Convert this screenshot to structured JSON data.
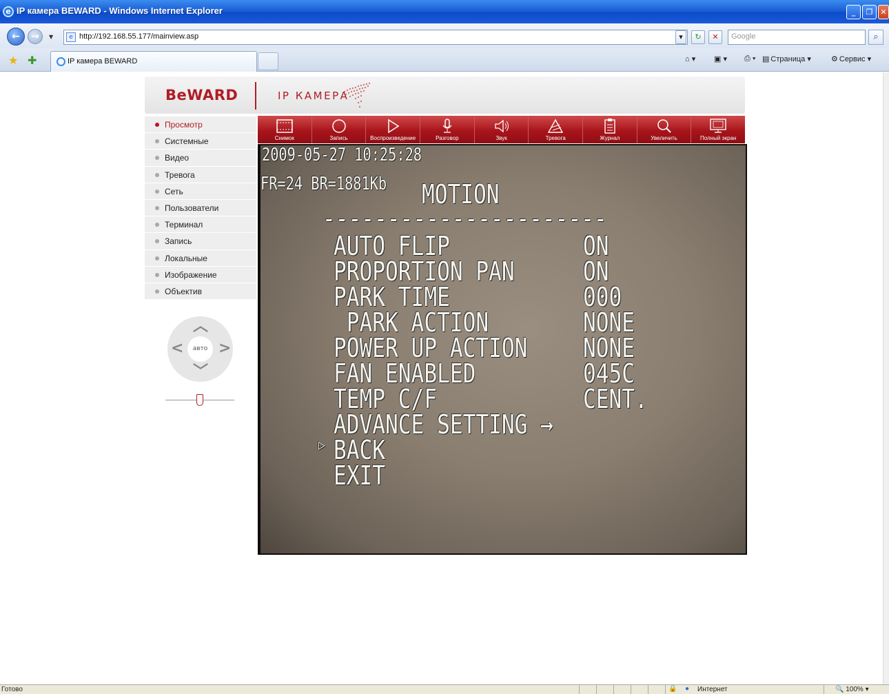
{
  "window": {
    "title": "IP камера BEWARD - Windows Internet Explorer"
  },
  "browser": {
    "url": "http://192.168.55.177/mainview.asp",
    "search_placeholder": "Google",
    "tab_label": "IP камера BEWARD",
    "page_menu": "Страница",
    "tools_menu": "Сервис"
  },
  "header": {
    "logo": "BeWARD",
    "product": "IP КАМЕРА"
  },
  "menu": [
    {
      "label": "Просмотр",
      "active": true
    },
    {
      "label": "Системные"
    },
    {
      "label": "Видео"
    },
    {
      "label": "Тревога"
    },
    {
      "label": "Сеть"
    },
    {
      "label": "Пользователи"
    },
    {
      "label": "Терминал"
    },
    {
      "label": "Запись"
    },
    {
      "label": "Локальные"
    },
    {
      "label": "Изображение"
    },
    {
      "label": "Объектив"
    }
  ],
  "ptz": {
    "center_label": "авто"
  },
  "toolbar": [
    {
      "label": "Снимок",
      "icon": "film-icon"
    },
    {
      "label": "Запись",
      "icon": "record-icon"
    },
    {
      "label": "Воспроизведение",
      "icon": "play-icon"
    },
    {
      "label": "Разговор",
      "icon": "microphone-icon"
    },
    {
      "label": "Звук",
      "icon": "speaker-icon"
    },
    {
      "label": "Тревога",
      "icon": "alarm-icon"
    },
    {
      "label": "Журнал",
      "icon": "clipboard-icon"
    },
    {
      "label": "Увеличить",
      "icon": "magnifier-icon"
    },
    {
      "label": "Полный экран",
      "icon": "monitor-icon"
    }
  ],
  "video": {
    "timestamp": "2009-05-27 10:25:28",
    "stream_info": "FR=24 BR=1881Kb",
    "osd_title": "MOTION",
    "osd_divider": "----------------------",
    "osd_menu": [
      {
        "label": "AUTO FLIP",
        "value": "ON"
      },
      {
        "label": "PROPORTION PAN",
        "value": "ON"
      },
      {
        "label": "PARK TIME",
        "value": "000"
      },
      {
        "label": " PARK ACTION",
        "value": "NONE"
      },
      {
        "label": "POWER UP ACTION",
        "value": "NONE"
      },
      {
        "label": "FAN ENABLED",
        "value": "045C"
      },
      {
        "label": "TEMP C/F",
        "value": "CENT."
      },
      {
        "label": "ADVANCE SETTING →",
        "value": ""
      },
      {
        "label": "BACK",
        "value": "",
        "selected": true
      },
      {
        "label": "EXIT",
        "value": ""
      }
    ]
  },
  "statusbar": {
    "text": "Готово",
    "zone": "Интернет",
    "zoom": "100%"
  }
}
